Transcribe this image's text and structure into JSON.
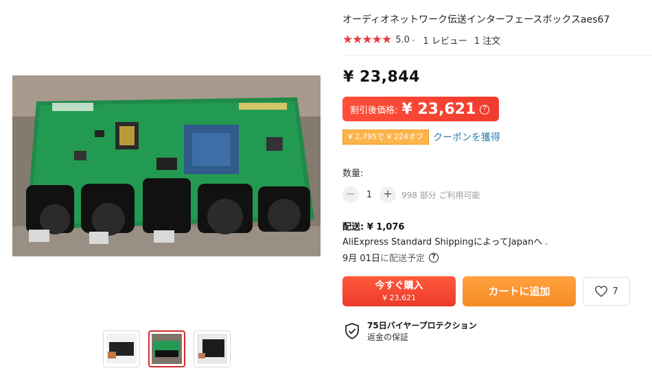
{
  "product": {
    "title": "オーディオネットワーク伝送インターフェースボックスaes67",
    "stars": "★★★★★",
    "rating": "5.0",
    "reviews": "1 レビュー",
    "orders": "1 注文"
  },
  "pricing": {
    "original_price": "¥ 23,844",
    "sale_label": "割引後価格:",
    "sale_price": "¥ 23,621",
    "help_glyph": "?",
    "coupon_tag": "¥ 2,795で ¥ 224オフ",
    "coupon_link": "クーポンを獲得"
  },
  "quantity": {
    "label": "数量:",
    "minus": "−",
    "value": "1",
    "plus": "+",
    "available": "998 部分 ご利用可能"
  },
  "shipping": {
    "title": "配送: ¥ 1,076",
    "method": "AliExpress Standard ShippingによってJapanへ",
    "chevron": "⌄",
    "delivery_date": "9月 01日",
    "delivery_suffix": "に配送予定",
    "question_glyph": "?"
  },
  "actions": {
    "buy_now": "今すぐ購入",
    "buy_now_price": "¥ 23,621",
    "add_to_cart": "カートに追加",
    "wishlist_count": "7"
  },
  "protection": {
    "title": "75日バイヤープロテクション",
    "subtitle": "返金の保証"
  },
  "colors": {
    "accent_red": "#f13b2d",
    "accent_orange": "#f68a22",
    "star_red": "#e83a3a",
    "link_blue": "#2a7bb0"
  },
  "icons": {
    "rating": "star-icon",
    "wishlist": "heart-icon",
    "protection": "shield-check-icon",
    "help": "question-circle-icon"
  }
}
